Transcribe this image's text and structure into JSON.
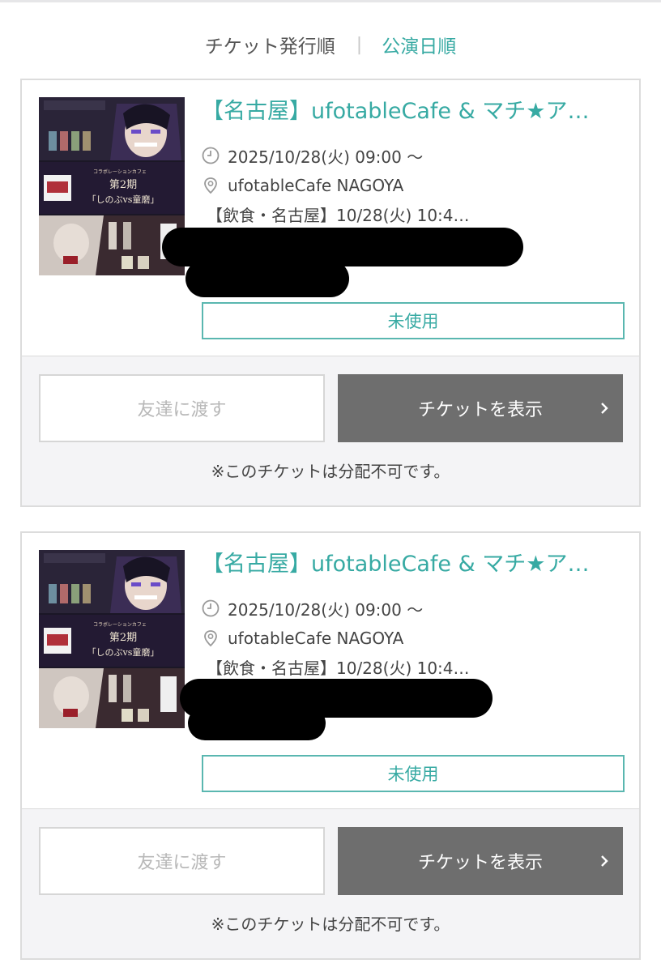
{
  "sort": {
    "by_issue": "チケット発行順",
    "separator": "|",
    "by_date": "公演日順"
  },
  "colors": {
    "accent": "#37aaa3",
    "button_dark": "#6e6e6e"
  },
  "tickets": [
    {
      "title": "【名古屋】ufotableCafe & マチ★ア…",
      "datetime": "2025/10/28(火) 09:00 ～",
      "venue": "ufotableCafe NAGOYA",
      "sub": "【飲食・名古屋】10/28(火) 10:4…",
      "status": "未使用",
      "transfer_label": "友達に渡す",
      "show_label": "チケットを表示",
      "note": "※このチケットは分配不可です。",
      "thumbnail": {
        "text": [
          "コラボレーションカフェ",
          "第2期",
          "「しのぶvs童磨」"
        ]
      }
    },
    {
      "title": "【名古屋】ufotableCafe & マチ★ア…",
      "datetime": "2025/10/28(火) 09:00 ～",
      "venue": "ufotableCafe NAGOYA",
      "sub": "【飲食・名古屋】10/28(火) 10:4…",
      "status": "未使用",
      "transfer_label": "友達に渡す",
      "show_label": "チケットを表示",
      "note": "※このチケットは分配不可です。",
      "thumbnail": {
        "text": [
          "コラボレーションカフェ",
          "第2期",
          "「しのぶvs童磨」"
        ]
      }
    }
  ],
  "icons": {
    "clock": "clock-icon",
    "location": "location-pin-icon",
    "chevron": "chevron-right-icon"
  }
}
